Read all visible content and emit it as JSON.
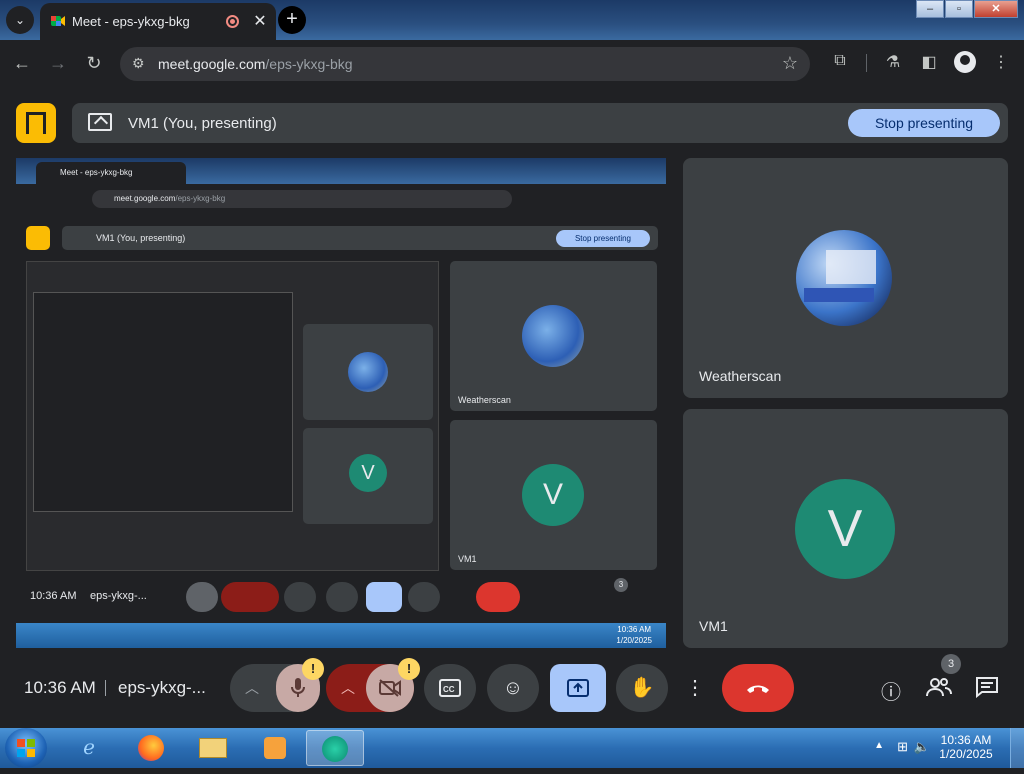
{
  "browser": {
    "tab_title": "Meet - eps-ykxg-bkg",
    "url_host": "meet.google.com",
    "url_path": "/eps-ykxg-bkg"
  },
  "meet": {
    "presenting_label": "VM1 (You, presenting)",
    "stop_presenting": "Stop presenting",
    "participants": [
      {
        "name": "Weatherscan"
      },
      {
        "name": "VM1",
        "initial": "V"
      }
    ],
    "time": "10:36 AM",
    "meeting_code": "eps-ykxg-...",
    "participant_count": "3",
    "warning_badge": "!"
  },
  "nested": {
    "tab_title": "Meet - eps-ykxg-bkg",
    "url_host": "meet.google.com",
    "url_path": "/eps-ykxg-bkg",
    "presenting_label": "VM1 (You, presenting)",
    "stop_presenting": "Stop presenting",
    "tile_names": [
      "Weatherscan",
      "VM1"
    ],
    "initial": "V",
    "time": "10:36 AM",
    "meeting_code": "eps-ykxg-...",
    "participant_count": "3",
    "tray_time": "10:36 AM",
    "tray_date": "1/20/2025"
  },
  "taskbar": {
    "time": "10:36 AM",
    "date": "1/20/2025"
  },
  "icons": {
    "colors": {
      "accent": "#a8c7fa",
      "hangup": "#dc362e",
      "brand": "#fbbc04",
      "avatar": "#1e8a73",
      "warning": "#fdd663"
    }
  }
}
